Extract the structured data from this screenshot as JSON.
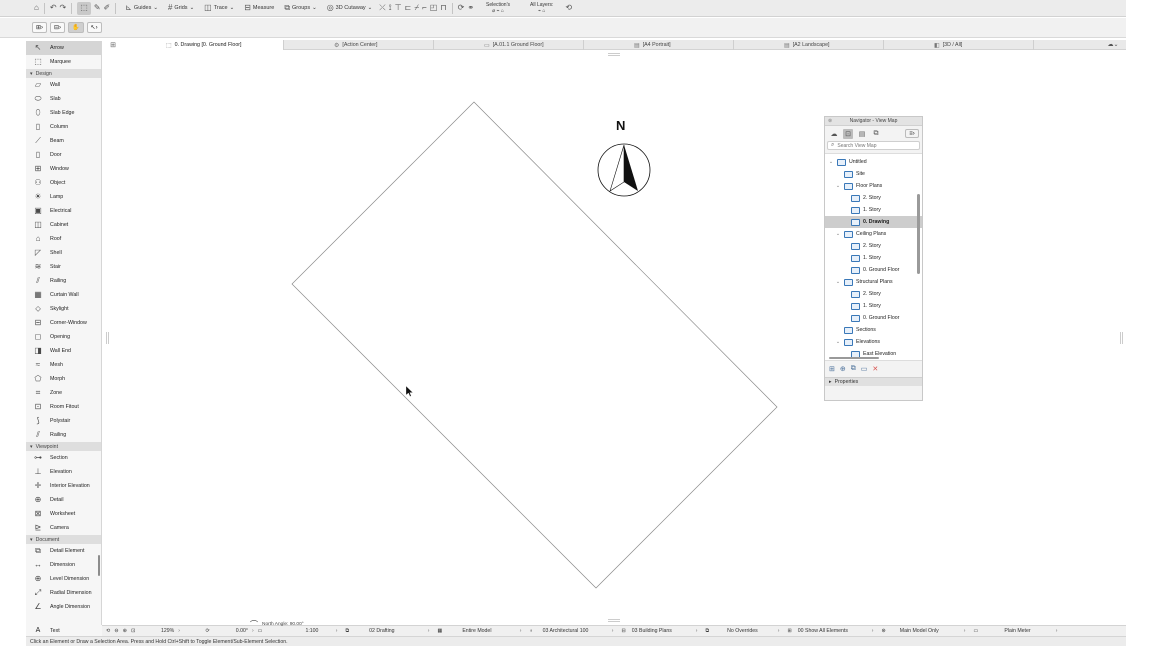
{
  "toolbar": {
    "guides": "Guides",
    "grids": "Grids",
    "trace": "Trace",
    "measure": "Measure",
    "groups": "Groups",
    "cutaway": "3D Cutaway",
    "selections_label": "Selection's",
    "all_layers_label": "All Layers:"
  },
  "tabs": [
    {
      "label": "0. Drawing [0. Ground Floor]"
    },
    {
      "label": "[Action Center]"
    },
    {
      "label": "[A.01.1 Ground Floor]"
    },
    {
      "label": "[A4 Portrait]"
    },
    {
      "label": "[A2 Landscape]"
    },
    {
      "label": "[3D / All]"
    }
  ],
  "toolbox": {
    "top": [
      {
        "label": "Arrow",
        "icon": "arrow-icon",
        "glyph": "↖"
      },
      {
        "label": "Marquee",
        "icon": "marquee-icon",
        "glyph": "⬚"
      }
    ],
    "design_label": "Design",
    "design": [
      {
        "label": "Wall",
        "icon": "wall-icon",
        "glyph": "▱"
      },
      {
        "label": "Slab",
        "icon": "slab-icon",
        "glyph": "⬭"
      },
      {
        "label": "Slab Edge",
        "icon": "slab-edge-icon",
        "glyph": "⬯"
      },
      {
        "label": "Column",
        "icon": "column-icon",
        "glyph": "▯"
      },
      {
        "label": "Beam",
        "icon": "beam-icon",
        "glyph": "⟋"
      },
      {
        "label": "Door",
        "icon": "door-icon",
        "glyph": "▯"
      },
      {
        "label": "Window",
        "icon": "window-icon",
        "glyph": "⊞"
      },
      {
        "label": "Object",
        "icon": "object-icon",
        "glyph": "⚇"
      },
      {
        "label": "Lamp",
        "icon": "lamp-icon",
        "glyph": "☀"
      },
      {
        "label": "Electrical",
        "icon": "electrical-icon",
        "glyph": "▣"
      },
      {
        "label": "Cabinet",
        "icon": "cabinet-icon",
        "glyph": "◫"
      },
      {
        "label": "Roof",
        "icon": "roof-icon",
        "glyph": "⌂"
      },
      {
        "label": "Shell",
        "icon": "shell-icon",
        "glyph": "◸"
      },
      {
        "label": "Stair",
        "icon": "stair-icon",
        "glyph": "≋"
      },
      {
        "label": "Railing",
        "icon": "railing-icon",
        "glyph": "⫽"
      },
      {
        "label": "Curtain Wall",
        "icon": "curtain-wall-icon",
        "glyph": "▦"
      },
      {
        "label": "Skylight",
        "icon": "skylight-icon",
        "glyph": "⬦"
      },
      {
        "label": "Corner-Window",
        "icon": "corner-window-icon",
        "glyph": "⊟"
      },
      {
        "label": "Opening",
        "icon": "opening-icon",
        "glyph": "◻"
      },
      {
        "label": "Wall End",
        "icon": "wall-end-icon",
        "glyph": "◨"
      },
      {
        "label": "Mesh",
        "icon": "mesh-icon",
        "glyph": "≈"
      },
      {
        "label": "Morph",
        "icon": "morph-icon",
        "glyph": "⬠"
      },
      {
        "label": "Zone",
        "icon": "zone-icon",
        "glyph": "⌗"
      },
      {
        "label": "Room Fitout",
        "icon": "room-fitout-icon",
        "glyph": "⊡"
      },
      {
        "label": "Polystair",
        "icon": "polystair-icon",
        "glyph": "⟆"
      },
      {
        "label": "Railing",
        "icon": "railing-2-icon",
        "glyph": "⫽"
      }
    ],
    "viewpoint_label": "Viewpoint",
    "viewpoint": [
      {
        "label": "Section",
        "icon": "section-icon",
        "glyph": "⊶"
      },
      {
        "label": "Elevation",
        "icon": "elevation-icon",
        "glyph": "⊥"
      },
      {
        "label": "Interior Elevation",
        "icon": "interior-elevation-icon",
        "glyph": "✛"
      },
      {
        "label": "Detail",
        "icon": "detail-icon",
        "glyph": "⊕"
      },
      {
        "label": "Worksheet",
        "icon": "worksheet-icon",
        "glyph": "⊠"
      },
      {
        "label": "Camera",
        "icon": "camera-icon",
        "glyph": "⊵"
      }
    ],
    "document_label": "Document",
    "document": [
      {
        "label": "Detail Element",
        "icon": "detail-element-icon",
        "glyph": "⧉"
      },
      {
        "label": "Dimension",
        "icon": "dimension-icon",
        "glyph": "↔"
      },
      {
        "label": "Level Dimension",
        "icon": "level-dimension-icon",
        "glyph": "⊕"
      },
      {
        "label": "Radial Dimension",
        "icon": "radial-dimension-icon",
        "glyph": "⤢"
      },
      {
        "label": "Angle Dimension",
        "icon": "angle-dimension-icon",
        "glyph": "∠"
      }
    ],
    "text_tool": {
      "label": "Text",
      "glyph": "A"
    }
  },
  "compass": {
    "label": "N"
  },
  "navigator": {
    "title": "Navigator - View Map",
    "search_placeholder": "Search View Map",
    "tree": [
      {
        "label": "Untitled",
        "level": 0,
        "toggle": "⌄",
        "selected": false
      },
      {
        "label": "Site",
        "level": 1,
        "toggle": "",
        "selected": false
      },
      {
        "label": "Floor Plans",
        "level": 1,
        "toggle": "⌄",
        "selected": false
      },
      {
        "label": "2. Story",
        "level": 2,
        "toggle": "",
        "selected": false
      },
      {
        "label": "1. Story",
        "level": 2,
        "toggle": "",
        "selected": false
      },
      {
        "label": "0. Drawing",
        "level": 2,
        "toggle": "",
        "selected": true
      },
      {
        "label": "Ceiling Plans",
        "level": 1,
        "toggle": "⌄",
        "selected": false
      },
      {
        "label": "2. Story",
        "level": 2,
        "toggle": "",
        "selected": false
      },
      {
        "label": "1. Story",
        "level": 2,
        "toggle": "",
        "selected": false
      },
      {
        "label": "0. Ground Floor",
        "level": 2,
        "toggle": "",
        "selected": false
      },
      {
        "label": "Structural Plans",
        "level": 1,
        "toggle": "⌄",
        "selected": false
      },
      {
        "label": "2. Story",
        "level": 2,
        "toggle": "",
        "selected": false
      },
      {
        "label": "1. Story",
        "level": 2,
        "toggle": "",
        "selected": false
      },
      {
        "label": "0. Ground Floor",
        "level": 2,
        "toggle": "",
        "selected": false
      },
      {
        "label": "Sections",
        "level": 1,
        "toggle": "",
        "selected": false
      },
      {
        "label": "Elevations",
        "level": 1,
        "toggle": "⌄",
        "selected": false
      },
      {
        "label": "East Elevation",
        "level": 2,
        "toggle": "",
        "selected": false
      }
    ],
    "properties_label": "Properties"
  },
  "statusbar": {
    "zoom": "129%",
    "angle": "0.00°",
    "scale": "1:100",
    "layer_combo": "02 Drafting",
    "model_view": "Entire Model",
    "pen_set": "03 Architectural 100",
    "renovation": "03 Building Plans",
    "overrides": "No Overrides",
    "show_elements": "00 Show All Elements",
    "model_only": "Main Model Only",
    "dimension": "Plain Meter",
    "north_angle": "North Angle: 90.00°"
  },
  "hint": "Click an Element or Draw a Selection Area. Press and Hold Ctrl+Shift to Toggle Element/Sub-Element Selection."
}
